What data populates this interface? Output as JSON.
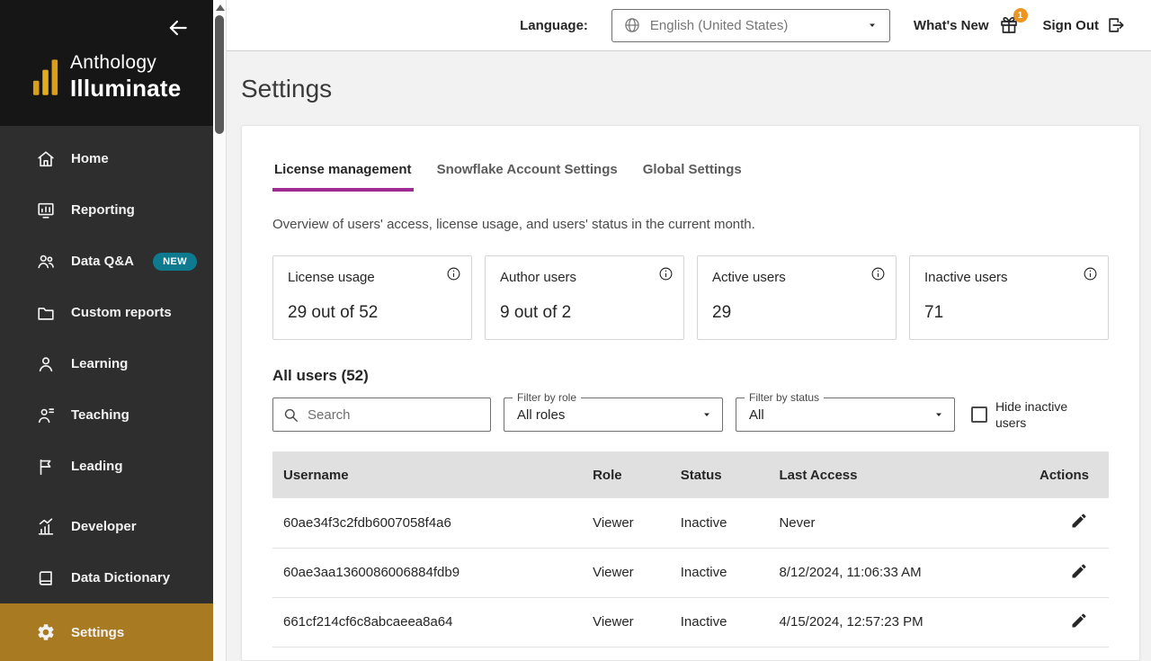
{
  "sidebar": {
    "logo_line1": "Anthology",
    "logo_line2": "Illuminate",
    "items": [
      {
        "label": "Home",
        "icon": "home-icon"
      },
      {
        "label": "Reporting",
        "icon": "reporting-icon"
      },
      {
        "label": "Data Q&A",
        "icon": "data-qa-icon",
        "badge": "NEW"
      },
      {
        "label": "Custom reports",
        "icon": "folder-icon"
      },
      {
        "label": "Learning",
        "icon": "learning-icon"
      },
      {
        "label": "Teaching",
        "icon": "teaching-icon"
      },
      {
        "label": "Leading",
        "icon": "leading-icon"
      },
      {
        "label": "Developer",
        "icon": "developer-icon"
      },
      {
        "label": "Data Dictionary",
        "icon": "data-dictionary-icon"
      },
      {
        "label": "Settings",
        "icon": "settings-gear-icon",
        "active": true
      }
    ]
  },
  "topbar": {
    "language_label": "Language:",
    "language_value": "English (United States)",
    "whats_new_label": "What's New",
    "whats_new_badge": "1",
    "sign_out_label": "Sign Out"
  },
  "page": {
    "title": "Settings"
  },
  "tabs": [
    {
      "label": "License management",
      "active": true
    },
    {
      "label": "Snowflake Account Settings",
      "active": false
    },
    {
      "label": "Global Settings",
      "active": false
    }
  ],
  "overview_text": "Overview of users' access, license usage, and users' status in the current month.",
  "stats": [
    {
      "label": "License usage",
      "value": "29 out of 52"
    },
    {
      "label": "Author users",
      "value": "9 out of 2"
    },
    {
      "label": "Active users",
      "value": "29"
    },
    {
      "label": "Inactive users",
      "value": "71"
    }
  ],
  "users": {
    "heading": "All users (52)",
    "search_placeholder": "Search",
    "filter_role_label": "Filter by role",
    "filter_role_value": "All roles",
    "filter_status_label": "Filter by status",
    "filter_status_value": "All",
    "hide_inactive_label": "Hide inactive users",
    "table": {
      "columns": [
        "Username",
        "Role",
        "Status",
        "Last Access",
        "Actions"
      ],
      "rows": [
        {
          "username": "60ae34f3c2fdb6007058f4a6",
          "role": "Viewer",
          "status": "Inactive",
          "last_access": "Never"
        },
        {
          "username": "60ae3aa1360086006884fdb9",
          "role": "Viewer",
          "status": "Inactive",
          "last_access": "8/12/2024, 11:06:33 AM"
        },
        {
          "username": "661cf214cf6c8abcaeea8a64",
          "role": "Viewer",
          "status": "Inactive",
          "last_access": "4/15/2024, 12:57:23 PM"
        }
      ]
    }
  },
  "colors": {
    "accent-gold": "#a87b22",
    "badge-teal": "#0e7a8f",
    "tab-accent": "#a02b93",
    "whats-new-badge": "#ee9421",
    "sidebar-bg": "#2e2e2e",
    "sidebar-top-bg": "#161616",
    "content-bg": "#f2f2f2",
    "logo-gold": "#d99e1c"
  }
}
